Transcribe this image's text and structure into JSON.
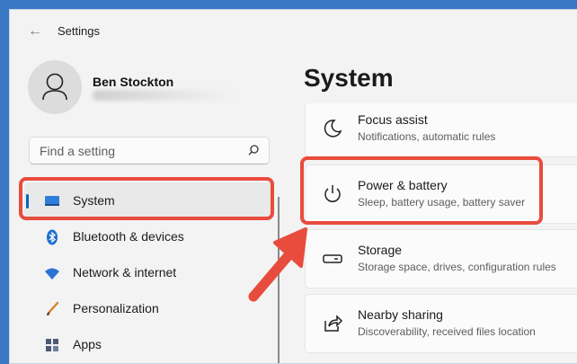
{
  "window": {
    "title": "Settings"
  },
  "user": {
    "name": "Ben Stockton"
  },
  "search": {
    "placeholder": "Find a setting"
  },
  "nav": {
    "items": [
      {
        "label": "System",
        "icon": "monitor-icon",
        "selected": true
      },
      {
        "label": "Bluetooth & devices",
        "icon": "bluetooth-icon"
      },
      {
        "label": "Network & internet",
        "icon": "wifi-icon"
      },
      {
        "label": "Personalization",
        "icon": "brush-icon"
      },
      {
        "label": "Apps",
        "icon": "apps-icon"
      }
    ]
  },
  "main": {
    "title": "System",
    "cards": [
      {
        "title": "Focus assist",
        "subtitle": "Notifications, automatic rules",
        "icon": "moon-icon"
      },
      {
        "title": "Power & battery",
        "subtitle": "Sleep, battery usage, battery saver",
        "icon": "power-icon"
      },
      {
        "title": "Storage",
        "subtitle": "Storage space, drives, configuration rules",
        "icon": "storage-icon"
      },
      {
        "title": "Nearby sharing",
        "subtitle": "Discoverability, received files location",
        "icon": "share-icon"
      }
    ]
  },
  "colors": {
    "accent": "#0067c0",
    "highlight": "#e84c3d",
    "desktop": "#3a78c4"
  }
}
